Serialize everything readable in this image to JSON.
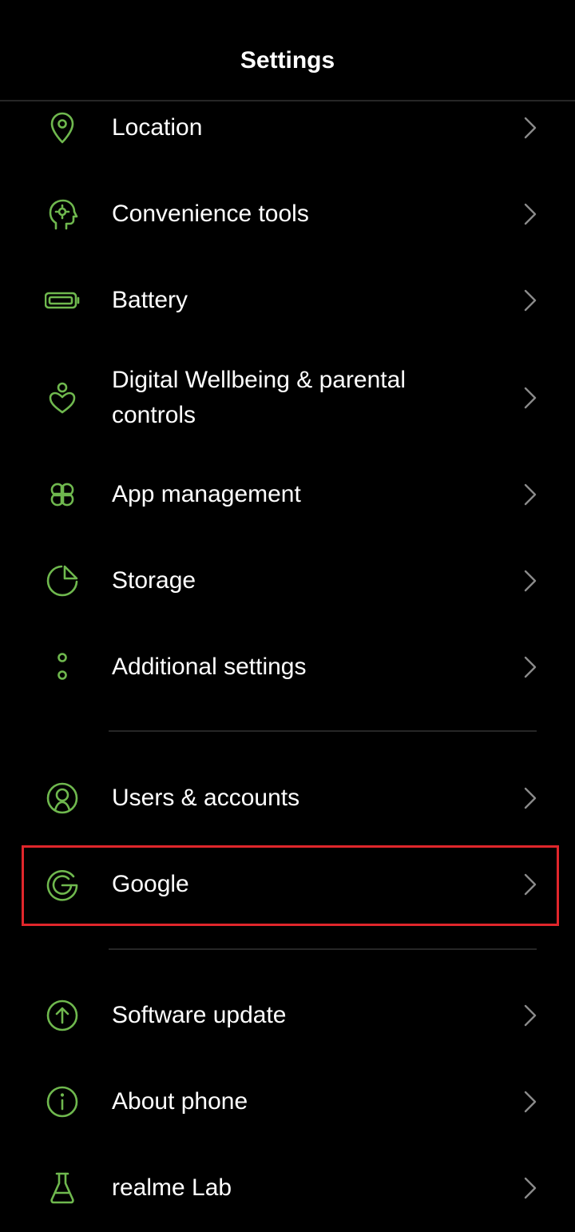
{
  "header": {
    "title": "Settings"
  },
  "colors": {
    "accent": "#6fb84e",
    "chevron": "#8a8a8a",
    "highlight": "#e0262b"
  },
  "items": [
    {
      "label": "Location",
      "icon": "location-pin-icon"
    },
    {
      "label": "Convenience tools",
      "icon": "head-gear-icon"
    },
    {
      "label": "Battery",
      "icon": "battery-icon"
    },
    {
      "label": "Digital Wellbeing & parental controls",
      "icon": "wellbeing-heart-icon"
    },
    {
      "label": "App management",
      "icon": "apps-grid-icon"
    },
    {
      "label": "Storage",
      "icon": "pie-chart-icon"
    },
    {
      "label": "Additional settings",
      "icon": "dots-icon"
    },
    {
      "label": "Users & accounts",
      "icon": "user-circle-icon"
    },
    {
      "label": "Google",
      "icon": "google-g-icon"
    },
    {
      "label": "Software update",
      "icon": "arrow-up-circle-icon"
    },
    {
      "label": "About phone",
      "icon": "info-icon"
    },
    {
      "label": "realme Lab",
      "icon": "flask-icon"
    }
  ]
}
